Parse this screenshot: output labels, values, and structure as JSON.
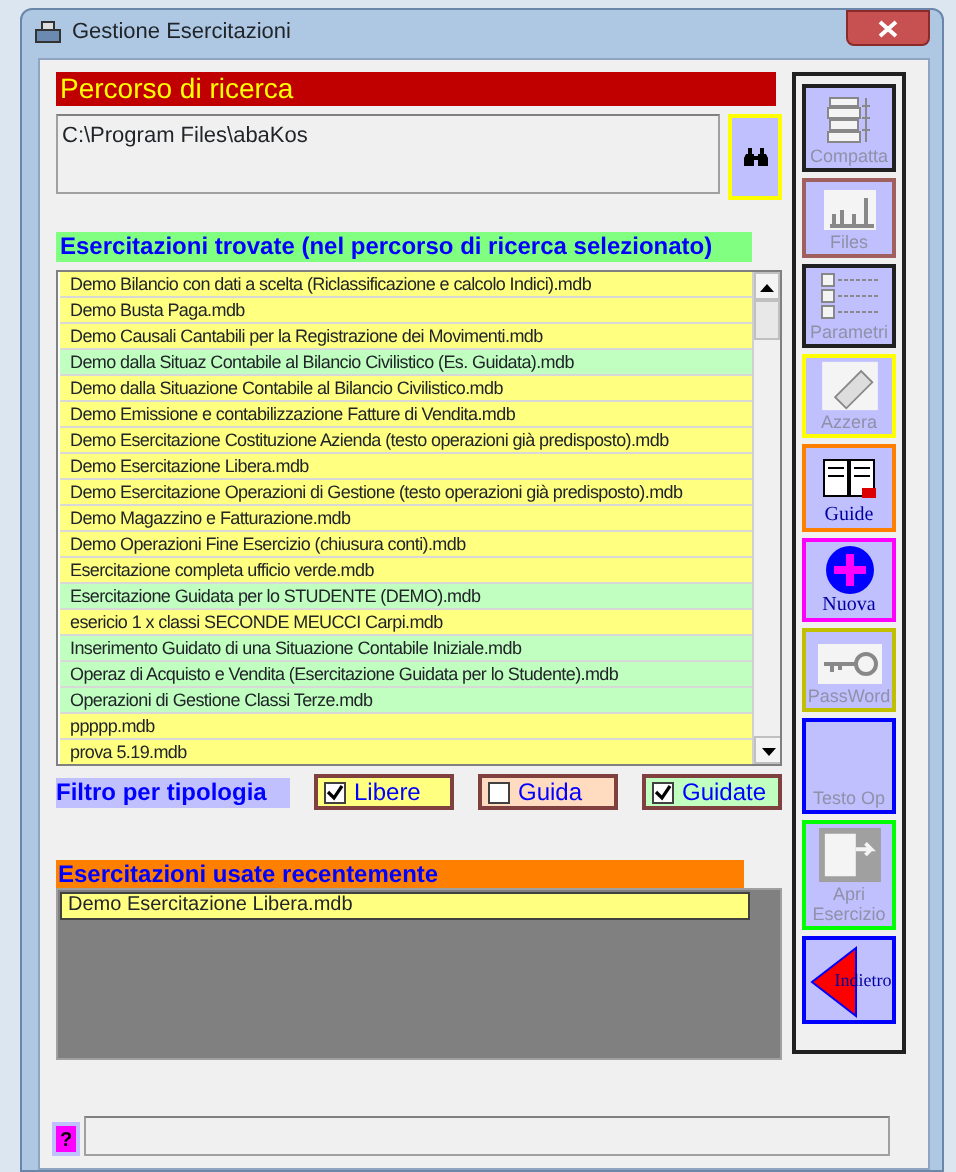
{
  "window": {
    "title": "Gestione Esercitazioni"
  },
  "search_path": {
    "heading": "Percorso di ricerca",
    "value": "C:\\Program Files\\abaKos"
  },
  "found": {
    "heading": "Esercitazioni trovate (nel percorso di ricerca selezionato)",
    "items": [
      {
        "label": "Demo Bilancio con dati a scelta (Riclassificazione e calcolo Indici).mdb",
        "kind": "libera"
      },
      {
        "label": "Demo Busta Paga.mdb",
        "kind": "libera"
      },
      {
        "label": "Demo Causali Cantabili per la Registrazione dei Movimenti.mdb",
        "kind": "libera"
      },
      {
        "label": "Demo dalla Situaz Contabile al Bilancio Civilistico (Es. Guidata).mdb",
        "kind": "guidata"
      },
      {
        "label": "Demo dalla Situazione Contabile al Bilancio Civilistico.mdb",
        "kind": "libera"
      },
      {
        "label": "Demo Emissione e contabilizzazione Fatture di Vendita.mdb",
        "kind": "libera"
      },
      {
        "label": "Demo Esercitazione Costituzione Azienda (testo operazioni già predisposto).mdb",
        "kind": "libera"
      },
      {
        "label": "Demo Esercitazione Libera.mdb",
        "kind": "libera"
      },
      {
        "label": "Demo Esercitazione Operazioni di Gestione (testo operazioni già predisposto).mdb",
        "kind": "libera"
      },
      {
        "label": "Demo Magazzino e Fatturazione.mdb",
        "kind": "libera"
      },
      {
        "label": "Demo Operazioni Fine Esercizio (chiusura conti).mdb",
        "kind": "libera"
      },
      {
        "label": "Esercitazione completa ufficio verde.mdb",
        "kind": "libera"
      },
      {
        "label": "Esercitazione Guidata per lo STUDENTE (DEMO).mdb",
        "kind": "guidata"
      },
      {
        "label": "esericio 1 x classi SECONDE MEUCCI Carpi.mdb",
        "kind": "libera"
      },
      {
        "label": "Inserimento Guidato di una Situazione Contabile Iniziale.mdb",
        "kind": "guidata"
      },
      {
        "label": "Operaz di Acquisto e Vendita (Esercitazione Guidata per lo Studente).mdb",
        "kind": "guidata"
      },
      {
        "label": "Operazioni di Gestione Classi Terze.mdb",
        "kind": "guidata"
      },
      {
        "label": "ppppp.mdb",
        "kind": "libera"
      },
      {
        "label": "prova 5.19.mdb",
        "kind": "libera"
      }
    ]
  },
  "filter": {
    "label": "Filtro per tipologia",
    "options": [
      {
        "label": "Libere",
        "checked": true,
        "color": "#ffff80"
      },
      {
        "label": "Guida",
        "checked": false,
        "color": "#ffdcc0"
      },
      {
        "label": "Guidate",
        "checked": true,
        "color": "#c0ffc0"
      }
    ]
  },
  "recent": {
    "heading": "Esercitazioni usate recentemente",
    "items": [
      {
        "label": "Demo Esercitazione Libera.mdb"
      }
    ]
  },
  "toolbar": [
    {
      "label": "Compatta",
      "disabled": true,
      "color": "#202020"
    },
    {
      "label": "Files",
      "disabled": true,
      "color": "#a06060"
    },
    {
      "label": "Parametri",
      "disabled": true,
      "color": "#202020"
    },
    {
      "label": "Azzera",
      "disabled": true,
      "color": "#ffff00"
    },
    {
      "label": "Guide",
      "disabled": false,
      "color": "#ff8000"
    },
    {
      "label": "Nuova",
      "disabled": false,
      "color": "#ff00ff"
    },
    {
      "label": "PassWord",
      "disabled": true,
      "color": "#c0c000"
    },
    {
      "label": "Testo Op",
      "disabled": true,
      "color": "#0000ff"
    },
    {
      "label": "Apri Esercizio",
      "disabled": true,
      "color": "#00ff00"
    },
    {
      "label": "Indietro",
      "disabled": false,
      "color": "#0000ff"
    }
  ],
  "help_button": {
    "label": "?"
  }
}
